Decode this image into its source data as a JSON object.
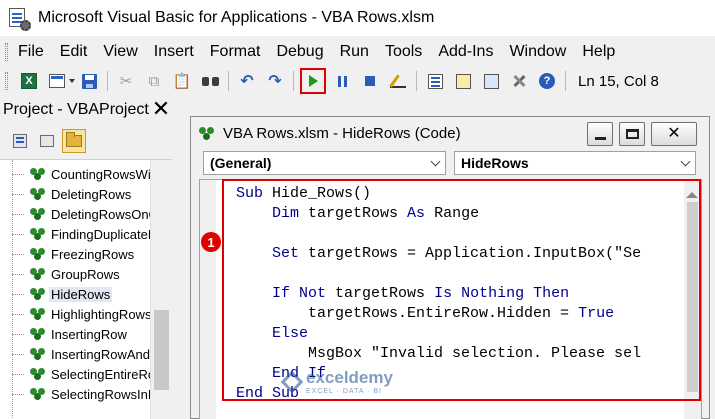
{
  "window": {
    "title": "Microsoft Visual Basic for Applications - VBA Rows.xlsm"
  },
  "menu": [
    "File",
    "Edit",
    "View",
    "Insert",
    "Format",
    "Debug",
    "Run",
    "Tools",
    "Add-Ins",
    "Window",
    "Help"
  ],
  "toolbar": {
    "status": "Ln 15, Col 8",
    "icons": [
      "excel-icon",
      "insert-module-icon",
      "save-icon",
      "cut-icon",
      "copy-icon",
      "paste-icon",
      "find-icon",
      "undo-icon",
      "redo-icon",
      "run-icon",
      "break-icon",
      "reset-icon",
      "design-mode-icon",
      "project-explorer-icon",
      "properties-icon",
      "object-browser-icon",
      "toolbox-icon",
      "help-icon"
    ],
    "highlight_color": "#e00000"
  },
  "project": {
    "title": "Project - VBAProject",
    "modules": [
      "CountingRowsWit",
      "DeletingRows",
      "DeletingRowsOnC",
      "FindingDuplicateR",
      "FreezingRows",
      "GroupRows",
      "HideRows",
      "HighlightingRows",
      "InsertingRow",
      "InsertingRowAnd(",
      "SelectingEntireRo",
      "SelectingRowsInR"
    ],
    "selected": "HideRows"
  },
  "code_window": {
    "title": "VBA Rows.xlsm - HideRows (Code)",
    "object_dropdown": "(General)",
    "procedure_dropdown": "HideRows",
    "lines": [
      [
        {
          "t": "Sub ",
          "k": true
        },
        {
          "t": "Hide_Rows()",
          "k": false
        }
      ],
      [
        {
          "t": "    Dim ",
          "k": true
        },
        {
          "t": "targetRows ",
          "k": false
        },
        {
          "t": "As ",
          "k": true
        },
        {
          "t": "Range",
          "k": false
        }
      ],
      [],
      [
        {
          "t": "    Set ",
          "k": true
        },
        {
          "t": "targetRows = Application.InputBox(\"Se",
          "k": false
        }
      ],
      [],
      [
        {
          "t": "    If Not ",
          "k": true
        },
        {
          "t": "targetRows ",
          "k": false
        },
        {
          "t": "Is Nothing Then",
          "k": true
        }
      ],
      [
        {
          "t": "        targetRows.EntireRow.Hidden = ",
          "k": false
        },
        {
          "t": "True",
          "k": true
        }
      ],
      [
        {
          "t": "    Else",
          "k": true
        }
      ],
      [
        {
          "t": "        MsgBox \"Invalid selection. Please sel",
          "k": false
        }
      ],
      [
        {
          "t": "    End If",
          "k": true
        }
      ],
      [
        {
          "t": "End Sub",
          "k": true
        }
      ]
    ],
    "annotation_badge": "1"
  },
  "watermark": {
    "name": "exceldemy",
    "tagline": "EXCEL · DATA · BI"
  }
}
